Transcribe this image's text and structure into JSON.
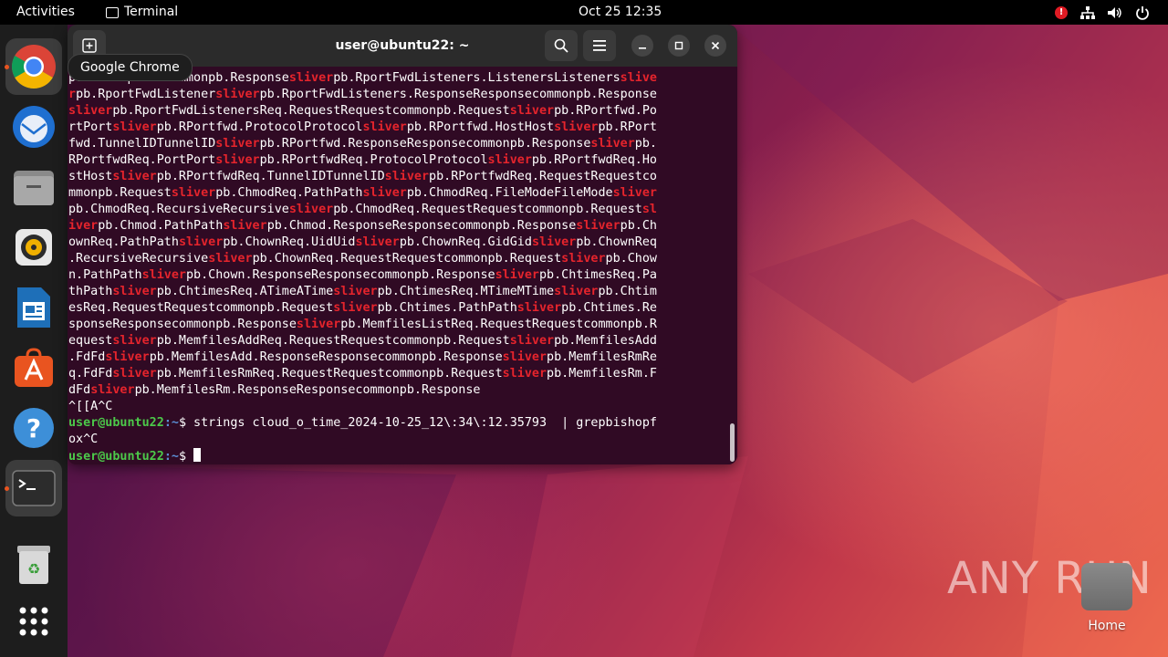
{
  "topbar": {
    "activities": "Activities",
    "app_name": "Terminal",
    "clock": "Oct 25  12:35",
    "alert_badge": "!"
  },
  "tooltip": "Google Chrome",
  "window": {
    "title": "user@ubuntu22: ~"
  },
  "terminal": {
    "highlight_word": "sliver",
    "wrapped_output_lines": [
      "ponseResponsecommonpb.ResponseSpb.RportFwdListeners.ListenersListenersslive",
      "rpb.RportFwdListenerSpb.RportFwdListeners.ResponseResponsecommonpb.Response",
      "Spb.RportFwdListenersReq.RequestRequestcommonpb.RequestSpb.RPortfwd.Po",
      "rtPortSpb.RPortfwd.ProtocolProtocolSpb.RPortfwd.HostHostSpb.RPort",
      "fwd.TunnelIDTunnelIDSpb.RPortfwd.ResponseResponsecommonpb.ResponseSpb.",
      "RPortfwdReq.PortPortSpb.RPortfwdReq.ProtocolProtocolSpb.RPortfwdReq.Ho",
      "stHostSpb.RPortfwdReq.TunnelIDTunnelIDSpb.RPortfwdReq.RequestRequestco",
      "mmonpb.RequestSpb.ChmodReq.PathPathSpb.ChmodReq.FileModeFileModeS",
      "pb.ChmodReq.RecursiveRecursiveSpb.ChmodReq.RequestRequestcommonpb.Requestsl",
      "iverpb.Chmod.PathPathSpb.Chmod.ResponseResponsecommonpb.ResponseSpb.Ch",
      "ownReq.PathPathSpb.ChownReq.UidUidSpb.ChownReq.GidGidSpb.ChownReq",
      ".RecursiveRecursiveSpb.ChownReq.RequestRequestcommonpb.RequestSpb.Chow",
      "n.PathPathSpb.Chown.ResponseResponsecommonpb.ResponseSpb.ChtimesReq.Pa",
      "thPathSpb.ChtimesReq.ATimeATimeSpb.ChtimesReq.MTimeMTimeSpb.Chtim",
      "esReq.RequestRequestcommonpb.RequestSpb.Chtimes.PathPathSpb.Chtimes.Re",
      "sponseResponsecommonpb.ResponseSpb.MemfilesListReq.RequestRequestcommonpb.R",
      "equestSpb.MemfilesAddReq.RequestRequestcommonpb.RequestSpb.MemfilesAdd",
      ".FdFdSpb.MemfilesAdd.ResponseResponsecommonpb.ResponseSpb.MemfilesRmRe",
      "q.FdFdSpb.MemfilesRmReq.RequestRequestcommonpb.RequestSpb.MemfilesRm.F",
      "dFdSpb.MemfilesRm.ResponseResponsecommonpb.Response"
    ],
    "interrupt_line": "^[[A^C",
    "prompt_user": "user@ubuntu22",
    "prompt_path": ":~",
    "prompt_symbol": "$",
    "command": " strings cloud_o_time_2024-10-25_12\\:34\\:12.35793  | grepbishopf",
    "command_wrap": "ox^C"
  },
  "desktop": {
    "watermark": "ANY RUN",
    "home_label": "Home"
  },
  "colors": {
    "terminal_bg": "#300a24",
    "highlight": "#e5242c",
    "prompt_user": "#4cc94a",
    "prompt_path": "#5b8fd6",
    "accent": "#e95420"
  },
  "dock": [
    {
      "name": "google-chrome",
      "icon": "chrome-icon"
    },
    {
      "name": "thunderbird",
      "icon": "thunderbird-icon"
    },
    {
      "name": "files",
      "icon": "files-icon"
    },
    {
      "name": "rhythmbox",
      "icon": "rhythmbox-icon"
    },
    {
      "name": "libreoffice-writer",
      "icon": "writer-icon"
    },
    {
      "name": "app-center",
      "icon": "app-center-icon"
    },
    {
      "name": "help",
      "icon": "help-icon"
    },
    {
      "name": "terminal",
      "icon": "terminal-icon"
    },
    {
      "name": "trash",
      "icon": "trash-icon"
    },
    {
      "name": "show-apps",
      "icon": "app-grid-icon"
    }
  ]
}
